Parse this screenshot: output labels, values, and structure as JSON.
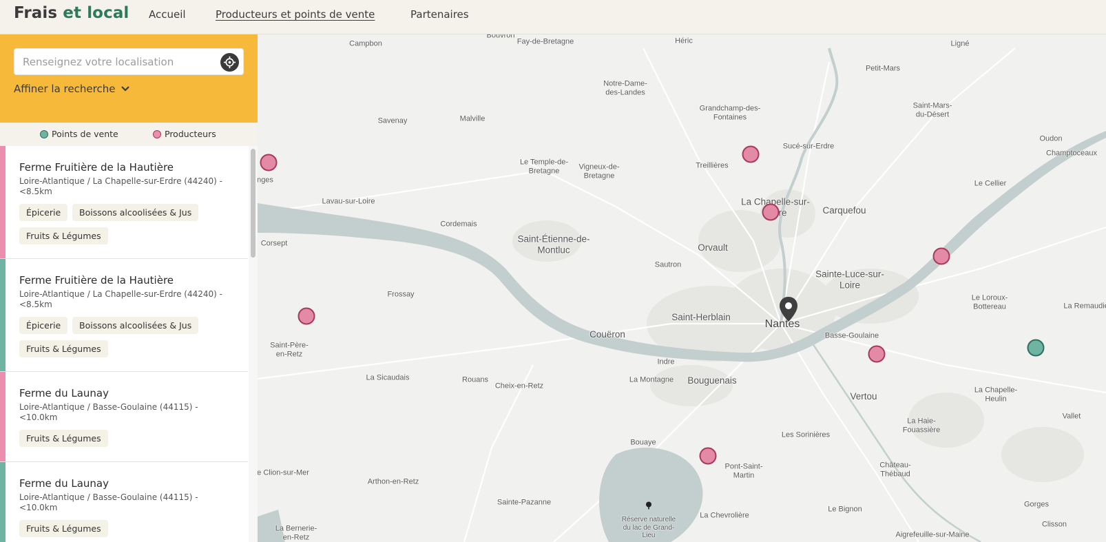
{
  "header": {
    "brand_prefix": "Frais",
    "brand_accent": "et local",
    "nav": [
      {
        "label": "Accueil"
      },
      {
        "label": "Producteurs et points de vente"
      },
      {
        "label": "Partenaires"
      }
    ]
  },
  "search": {
    "placeholder": "Renseignez votre localisation",
    "locate_icon": "crosshair-icon",
    "refine_label": "Affiner la recherche",
    "refine_icon": "chevron-down-icon"
  },
  "legend": {
    "sale_points": "Points de vente",
    "producers": "Producteurs"
  },
  "cards": [
    {
      "title": "Ferme Fruitière de la Hautière",
      "location": "Loire-Atlantique / La Chapelle-sur-Erdre (44240) - <8.5km",
      "tags": [
        "Épicerie",
        "Boissons alcoolisées & Jus",
        "Fruits & Légumes"
      ],
      "type": "producer"
    },
    {
      "title": "Ferme Fruitière de la Hautière",
      "location": "Loire-Atlantique / La Chapelle-sur-Erdre (44240) - <8.5km",
      "tags": [
        "Épicerie",
        "Boissons alcoolisées & Jus",
        "Fruits & Légumes"
      ],
      "type": "sale_point"
    },
    {
      "title": "Ferme du Launay",
      "location": "Loire-Atlantique / Basse-Goulaine (44115) - <10.0km",
      "tags": [
        "Fruits & Légumes"
      ],
      "type": "producer"
    },
    {
      "title": "Ferme du Launay",
      "location": "Loire-Atlantique / Basse-Goulaine (44115) - <10.0km",
      "tags": [
        "Fruits & Légumes"
      ],
      "type": "sale_point"
    }
  ],
  "colors": {
    "producer": "#ec8fae",
    "sale_point": "#6fb3a3",
    "brand_accent": "#2a7a5b",
    "search_panel": "#f6b93a"
  },
  "map": {
    "places_large": [
      "Nantes",
      "Saint-Herblain",
      "Bouguenais",
      "Vertou",
      "Couëron",
      "Orvault",
      "Carquefou",
      "Saint-Étienne-de-Montluc",
      "La Chapelle-sur-Erdre",
      "Sainte-Luce-sur-Loire"
    ],
    "places_small": [
      "Bouvron",
      "Campbon",
      "Fay-de-Bretagne",
      "Héric",
      "Ligné",
      "Petit-Mars",
      "Notre-Dame-des-Landes",
      "Grandchamp-des-Fontaines",
      "Saint-Mars-du-Désert",
      "Savenay",
      "Malville",
      "Sucé-sur-Erdre",
      "Oudon",
      "Champtoceaux",
      "Le Temple-de-Bretagne",
      "Vigneux-de-Bretagne",
      "Treillières",
      "Le Cellier",
      "Lavau-sur-Loire",
      "Cordemais",
      "Corsept",
      "Sautron",
      "Le Loroux-Bottereau",
      "La Remaudière",
      "Frossay",
      "Basse-Goulaine",
      "Saint-Père-en-Retz",
      "Indre",
      "La Sicaudais",
      "Rouans",
      "Cheix-en-Retz",
      "La Montagne",
      "La Chapelle-Heulin",
      "Vallet",
      "La Haie-Fouassière",
      "Les Sorinières",
      "Bouaye",
      "Château-Thébaud",
      "Pont-Saint-Martin",
      "Arthon-en-Retz",
      "Le Clion-sur-Mer",
      "Sainte-Pazanne",
      "Le Bignon",
      "Gorges",
      "La Chevrolière",
      "Aigrefeuille-sur-Maine",
      "Clisson",
      "La Bernerie-en-Retz",
      "Réserve naturelle du lac de Grand-Lieu",
      "nges"
    ],
    "pin_icon": "location-pin-icon",
    "reserve_icon": "tree-icon"
  }
}
